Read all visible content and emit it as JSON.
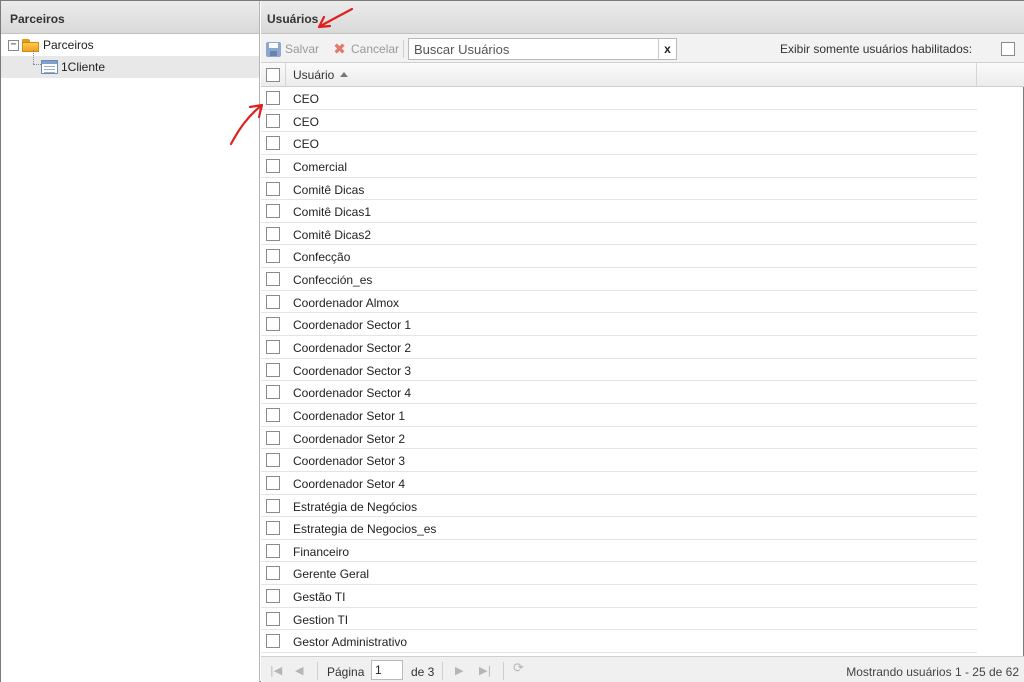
{
  "left_panel": {
    "title": "Parceiros",
    "tree": {
      "root": {
        "label": "Parceiros",
        "toggle": "−",
        "icon": "folder-icon"
      },
      "children": [
        {
          "label": "1Cliente",
          "icon": "document-icon"
        }
      ]
    }
  },
  "right_panel": {
    "title": "Usuários",
    "toolbar": {
      "save_label": "Salvar",
      "cancel_label": "Cancelar",
      "search_placeholder": "Buscar Usuários",
      "clear_label": "x",
      "filter_label": "Exibir somente usuários habilitados:",
      "filter_checked": false
    },
    "grid": {
      "column_header": "Usuário",
      "sort": "ascending",
      "rows": [
        "CEO",
        "CEO",
        "CEO",
        "Comercial",
        "Comitê Dicas",
        "Comitê Dicas1",
        "Comitê Dicas2",
        "Confecção",
        "Confección_es",
        "Coordenador Almox",
        "Coordenador Sector 1",
        "Coordenador Sector 2",
        "Coordenador Sector 3",
        "Coordenador Sector 4",
        "Coordenador Setor 1",
        "Coordenador Setor 2",
        "Coordenador Setor 3",
        "Coordenador Setor 4",
        "Estratégia de Negócios",
        "Estrategia de Negocios_es",
        "Financeiro",
        "Gerente Geral",
        "Gestão TI",
        "Gestion TI",
        "Gestor Administrativo"
      ]
    },
    "pager": {
      "page_label": "Página",
      "page_value": "1",
      "of_label": "de 3",
      "status": "Mostrando usuários 1 - 25 de 62"
    }
  },
  "annotation_color": "#e02020"
}
